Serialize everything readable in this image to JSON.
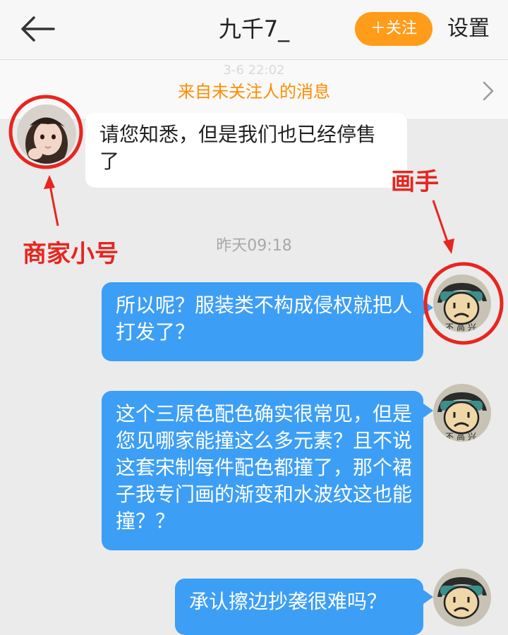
{
  "header": {
    "back_icon": "arrow-left-icon",
    "title": "九千7_",
    "follow_label": "＋关注",
    "settings_label": "设置",
    "accent_color": "#ff9c1a"
  },
  "notice": {
    "timestamp": "3-6 22:02",
    "text": "来自未关注人的消息",
    "chevron_icon": "chevron-right-icon"
  },
  "messages": [
    {
      "side": "left",
      "sender": "shop",
      "text": "请您知悉，但是我们也已经停售了"
    },
    {
      "side": "right",
      "sender": "painter",
      "text": "所以呢？服装类不构成侵权就把人打发了？"
    },
    {
      "side": "right",
      "sender": "painter",
      "text": "这个三原色配色确实很常见，但是您见哪家能撞这么多元素？且不说这套宋制每件配色都撞了，那个裙子我专门画的渐变和水波纹这也能撞？？"
    },
    {
      "side": "right",
      "sender": "painter",
      "text": "承认擦边抄袭很难吗？"
    }
  ],
  "time_divider": "昨天09:18",
  "painter_avatar_text": "不高兴",
  "annotations": {
    "shop_label": "商家小号",
    "painter_label": "画手",
    "color": "#e8251f"
  },
  "bubble_color": "#3d9ef5"
}
